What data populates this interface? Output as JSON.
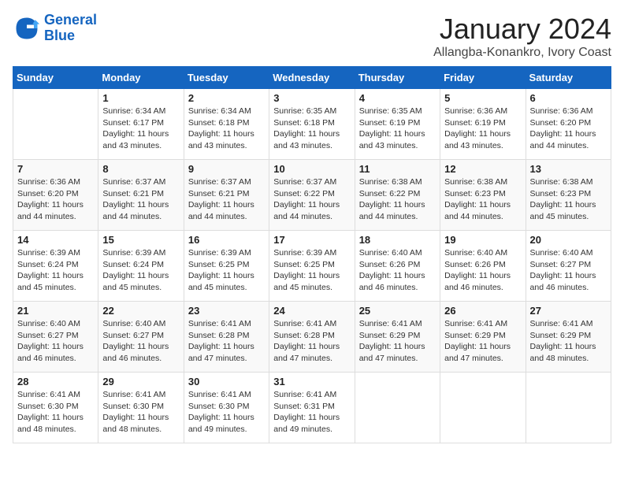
{
  "header": {
    "logo_line1": "General",
    "logo_line2": "Blue",
    "month_title": "January 2024",
    "subtitle": "Allangba-Konankro, Ivory Coast"
  },
  "weekdays": [
    "Sunday",
    "Monday",
    "Tuesday",
    "Wednesday",
    "Thursday",
    "Friday",
    "Saturday"
  ],
  "weeks": [
    [
      {
        "day": "",
        "info": ""
      },
      {
        "day": "1",
        "info": "Sunrise: 6:34 AM\nSunset: 6:17 PM\nDaylight: 11 hours\nand 43 minutes."
      },
      {
        "day": "2",
        "info": "Sunrise: 6:34 AM\nSunset: 6:18 PM\nDaylight: 11 hours\nand 43 minutes."
      },
      {
        "day": "3",
        "info": "Sunrise: 6:35 AM\nSunset: 6:18 PM\nDaylight: 11 hours\nand 43 minutes."
      },
      {
        "day": "4",
        "info": "Sunrise: 6:35 AM\nSunset: 6:19 PM\nDaylight: 11 hours\nand 43 minutes."
      },
      {
        "day": "5",
        "info": "Sunrise: 6:36 AM\nSunset: 6:19 PM\nDaylight: 11 hours\nand 43 minutes."
      },
      {
        "day": "6",
        "info": "Sunrise: 6:36 AM\nSunset: 6:20 PM\nDaylight: 11 hours\nand 44 minutes."
      }
    ],
    [
      {
        "day": "7",
        "info": "Sunrise: 6:36 AM\nSunset: 6:20 PM\nDaylight: 11 hours\nand 44 minutes."
      },
      {
        "day": "8",
        "info": "Sunrise: 6:37 AM\nSunset: 6:21 PM\nDaylight: 11 hours\nand 44 minutes."
      },
      {
        "day": "9",
        "info": "Sunrise: 6:37 AM\nSunset: 6:21 PM\nDaylight: 11 hours\nand 44 minutes."
      },
      {
        "day": "10",
        "info": "Sunrise: 6:37 AM\nSunset: 6:22 PM\nDaylight: 11 hours\nand 44 minutes."
      },
      {
        "day": "11",
        "info": "Sunrise: 6:38 AM\nSunset: 6:22 PM\nDaylight: 11 hours\nand 44 minutes."
      },
      {
        "day": "12",
        "info": "Sunrise: 6:38 AM\nSunset: 6:23 PM\nDaylight: 11 hours\nand 44 minutes."
      },
      {
        "day": "13",
        "info": "Sunrise: 6:38 AM\nSunset: 6:23 PM\nDaylight: 11 hours\nand 45 minutes."
      }
    ],
    [
      {
        "day": "14",
        "info": "Sunrise: 6:39 AM\nSunset: 6:24 PM\nDaylight: 11 hours\nand 45 minutes."
      },
      {
        "day": "15",
        "info": "Sunrise: 6:39 AM\nSunset: 6:24 PM\nDaylight: 11 hours\nand 45 minutes."
      },
      {
        "day": "16",
        "info": "Sunrise: 6:39 AM\nSunset: 6:25 PM\nDaylight: 11 hours\nand 45 minutes."
      },
      {
        "day": "17",
        "info": "Sunrise: 6:39 AM\nSunset: 6:25 PM\nDaylight: 11 hours\nand 45 minutes."
      },
      {
        "day": "18",
        "info": "Sunrise: 6:40 AM\nSunset: 6:26 PM\nDaylight: 11 hours\nand 46 minutes."
      },
      {
        "day": "19",
        "info": "Sunrise: 6:40 AM\nSunset: 6:26 PM\nDaylight: 11 hours\nand 46 minutes."
      },
      {
        "day": "20",
        "info": "Sunrise: 6:40 AM\nSunset: 6:27 PM\nDaylight: 11 hours\nand 46 minutes."
      }
    ],
    [
      {
        "day": "21",
        "info": "Sunrise: 6:40 AM\nSunset: 6:27 PM\nDaylight: 11 hours\nand 46 minutes."
      },
      {
        "day": "22",
        "info": "Sunrise: 6:40 AM\nSunset: 6:27 PM\nDaylight: 11 hours\nand 46 minutes."
      },
      {
        "day": "23",
        "info": "Sunrise: 6:41 AM\nSunset: 6:28 PM\nDaylight: 11 hours\nand 47 minutes."
      },
      {
        "day": "24",
        "info": "Sunrise: 6:41 AM\nSunset: 6:28 PM\nDaylight: 11 hours\nand 47 minutes."
      },
      {
        "day": "25",
        "info": "Sunrise: 6:41 AM\nSunset: 6:29 PM\nDaylight: 11 hours\nand 47 minutes."
      },
      {
        "day": "26",
        "info": "Sunrise: 6:41 AM\nSunset: 6:29 PM\nDaylight: 11 hours\nand 47 minutes."
      },
      {
        "day": "27",
        "info": "Sunrise: 6:41 AM\nSunset: 6:29 PM\nDaylight: 11 hours\nand 48 minutes."
      }
    ],
    [
      {
        "day": "28",
        "info": "Sunrise: 6:41 AM\nSunset: 6:30 PM\nDaylight: 11 hours\nand 48 minutes."
      },
      {
        "day": "29",
        "info": "Sunrise: 6:41 AM\nSunset: 6:30 PM\nDaylight: 11 hours\nand 48 minutes."
      },
      {
        "day": "30",
        "info": "Sunrise: 6:41 AM\nSunset: 6:30 PM\nDaylight: 11 hours\nand 49 minutes."
      },
      {
        "day": "31",
        "info": "Sunrise: 6:41 AM\nSunset: 6:31 PM\nDaylight: 11 hours\nand 49 minutes."
      },
      {
        "day": "",
        "info": ""
      },
      {
        "day": "",
        "info": ""
      },
      {
        "day": "",
        "info": ""
      }
    ]
  ]
}
